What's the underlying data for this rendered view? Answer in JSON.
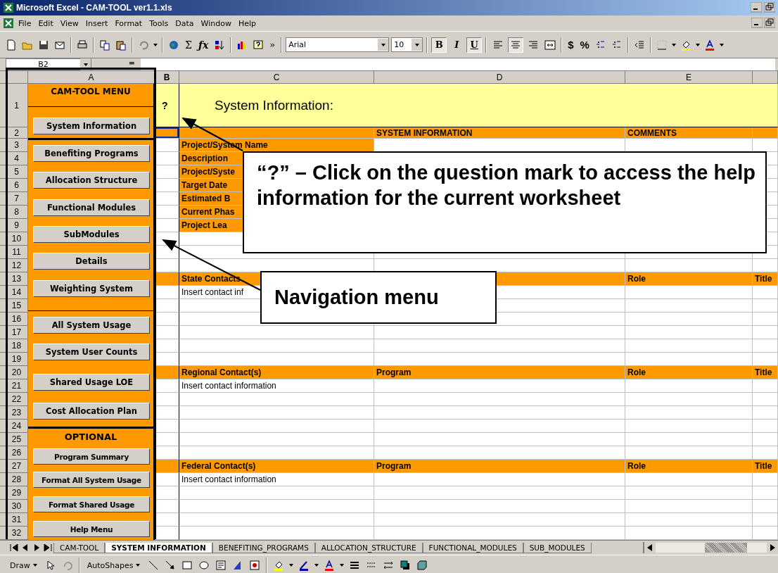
{
  "window": {
    "title": "Microsoft Excel - CAM-TOOL ver1.1.xls"
  },
  "menu_bar": [
    "File",
    "Edit",
    "View",
    "Insert",
    "Format",
    "Tools",
    "Data",
    "Window",
    "Help"
  ],
  "toolbar": {
    "glyphs": [
      "Σ",
      "ƒx",
      "»",
      "$",
      "%"
    ],
    "font": "Arial",
    "size": "10",
    "format_buttons": [
      {
        "label": "B",
        "selected": true
      },
      {
        "label": "I",
        "selected": false
      },
      {
        "label": "U",
        "selected": true
      }
    ],
    "align_buttons": [
      {
        "selected": false
      },
      {
        "selected": true
      },
      {
        "selected": false
      }
    ]
  },
  "formula_bar": {
    "name_box": "B2",
    "equals": "="
  },
  "columns": [
    "A",
    "B",
    "C",
    "D",
    "E"
  ],
  "nav_menu": {
    "title": "CAM-TOOL MENU",
    "optional_heading": "OPTIONAL",
    "buttons": [
      "System Information",
      "Benefiting Programs",
      "Allocation Structure",
      "Functional Modules",
      "SubModules",
      "Details",
      "Weighting System",
      "All System Usage",
      "System User Counts",
      "Shared Usage LOE",
      "Cost Allocation Plan",
      "Program Summary",
      "Format All System Usage",
      "Format Shared Usage",
      "Help Menu"
    ]
  },
  "rows": [
    {
      "number": "1",
      "kind": "title",
      "selected": false,
      "b": "?",
      "c": "System Information:"
    },
    {
      "number": "2",
      "kind": "header",
      "selected": true,
      "d": "SYSTEM INFORMATION",
      "e": "COMMENTS"
    },
    {
      "number": "3",
      "kind": "field",
      "selected": false,
      "c": "Project/System Name"
    },
    {
      "number": "4",
      "kind": "field",
      "selected": false,
      "c": "Description"
    },
    {
      "number": "5",
      "kind": "field",
      "selected": false,
      "c": "Project/Syste"
    },
    {
      "number": "6",
      "kind": "field",
      "selected": false,
      "c": "Target Date"
    },
    {
      "number": "7",
      "kind": "field",
      "selected": false,
      "c": "Estimated B"
    },
    {
      "number": "8",
      "kind": "field",
      "selected": false,
      "c": "Current Phas"
    },
    {
      "number": "9",
      "kind": "field",
      "selected": false,
      "c": "Project Lea"
    },
    {
      "number": "10",
      "kind": "empty",
      "selected": false
    },
    {
      "number": "11",
      "kind": "empty",
      "selected": false
    },
    {
      "number": "12",
      "kind": "empty",
      "selected": false
    },
    {
      "number": "13",
      "kind": "header",
      "selected": false,
      "c": "State Contacts",
      "e": "Role",
      "f": "Title"
    },
    {
      "number": "14",
      "kind": "plain",
      "selected": false,
      "c": "Insert contact inf"
    },
    {
      "number": "15",
      "kind": "empty",
      "selected": false
    },
    {
      "number": "16",
      "kind": "empty",
      "selected": false
    },
    {
      "number": "17",
      "kind": "empty",
      "selected": false
    },
    {
      "number": "18",
      "kind": "empty",
      "selected": false
    },
    {
      "number": "19",
      "kind": "empty",
      "selected": false
    },
    {
      "number": "20",
      "kind": "header",
      "selected": false,
      "c": "Regional Contact(s)",
      "d": "Program",
      "e": "Role",
      "f": "Title"
    },
    {
      "number": "21",
      "kind": "plain",
      "selected": false,
      "c": "Insert contact information"
    },
    {
      "number": "22",
      "kind": "empty",
      "selected": false
    },
    {
      "number": "23",
      "kind": "empty",
      "selected": false
    },
    {
      "number": "24",
      "kind": "empty",
      "selected": false
    },
    {
      "number": "25",
      "kind": "empty",
      "selected": false
    },
    {
      "number": "26",
      "kind": "empty",
      "selected": false
    },
    {
      "number": "27",
      "kind": "header",
      "selected": false,
      "c": "Federal Contact(s)",
      "d": "Program",
      "e": "Role",
      "f": "Title"
    },
    {
      "number": "28",
      "kind": "plain",
      "selected": false,
      "c": "Insert contact information"
    },
    {
      "number": "29",
      "kind": "empty",
      "selected": false
    },
    {
      "number": "30",
      "kind": "empty",
      "selected": false
    },
    {
      "number": "31",
      "kind": "empty",
      "selected": false
    },
    {
      "number": "32",
      "kind": "empty",
      "selected": false
    }
  ],
  "callouts": [
    "“?” – Click on the question mark to access the help information for the current worksheet",
    "Navigation menu"
  ],
  "sheet_tabs": [
    {
      "label": "CAM-TOOL",
      "selected": false
    },
    {
      "label": "SYSTEM INFORMATION",
      "selected": true
    },
    {
      "label": "BENEFITING_PROGRAMS",
      "selected": false
    },
    {
      "label": "ALLOCATION_STRUCTURE",
      "selected": false
    },
    {
      "label": "FUNCTIONAL_MODULES",
      "selected": false
    },
    {
      "label": "SUB_MODULES",
      "selected": false
    }
  ],
  "drawing_toolbar": {
    "draw": "Draw",
    "autoshapes": "AutoShapes"
  }
}
